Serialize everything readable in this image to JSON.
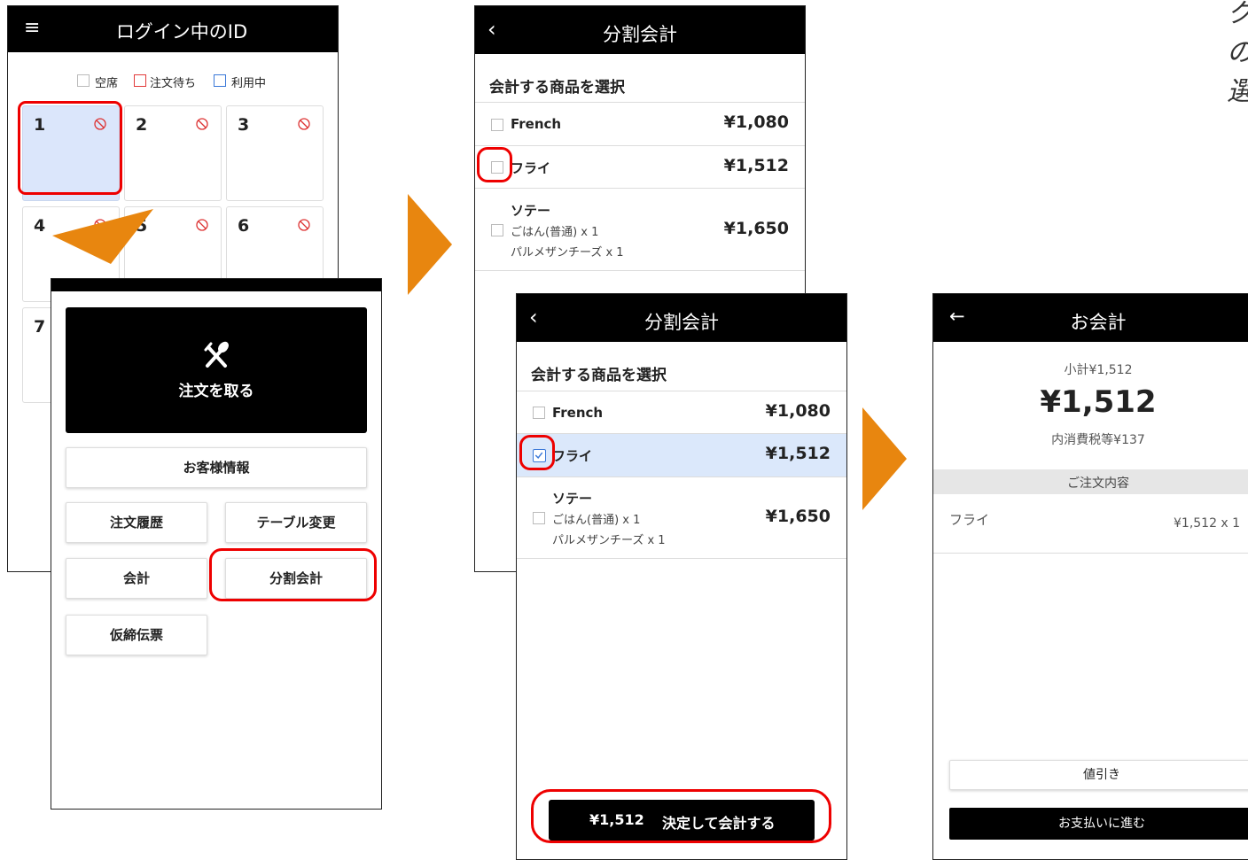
{
  "screen1": {
    "title": "ログイン中のID",
    "menu_icon": "hamburger-icon",
    "legend": [
      {
        "label": "空席",
        "color": "#bbbbbb"
      },
      {
        "label": "注文待ち",
        "color": "#e23b3b"
      },
      {
        "label": "利用中",
        "color": "#3a78d8"
      }
    ],
    "tables": [
      "1",
      "2",
      "3",
      "4",
      "5",
      "6",
      "7"
    ],
    "no_smoking_icon": "no-smoking-icon"
  },
  "menu_sheet": {
    "take_order_icon": "fork-knife-icon",
    "take_order": "注文を取る",
    "customer_info": "お客様情報",
    "order_history": "注文履歴",
    "table_change": "テーブル変更",
    "checkout": "会計",
    "split_checkout": "分割会計",
    "provisional_slip": "仮締伝票"
  },
  "split_screen": {
    "title": "分割会計",
    "back_icon": "chevron-left-icon",
    "section_title": "会計する商品を選択",
    "items": [
      {
        "name": "French",
        "price": "¥1,080"
      },
      {
        "name": "フライ",
        "price": "¥1,512"
      },
      {
        "name": "ソテー",
        "price": "¥1,650",
        "options": [
          "ごはん(普通) x 1",
          "パルメザンチーズ x 1"
        ]
      }
    ]
  },
  "split_screen_selected": {
    "title": "分割会計",
    "section_title": "会計する商品を選択",
    "items": [
      {
        "name": "French",
        "price": "¥1,080",
        "checked": false
      },
      {
        "name": "フライ",
        "price": "¥1,512",
        "checked": true
      },
      {
        "name": "ソテー",
        "price": "¥1,650",
        "checked": false,
        "options": [
          "ごはん(普通) x 1",
          "パルメザンチーズ x 1"
        ]
      }
    ],
    "confirm_amount": "¥1,512",
    "confirm_label": "決定して会計する",
    "selected_bg": "#dbe8fb"
  },
  "checkout_screen": {
    "title": "お会計",
    "back_icon": "arrow-left-icon",
    "subtotal": "小計¥1,512",
    "total": "¥1,512",
    "tax": "内消費税等¥137",
    "order_header": "ご注文内容",
    "order_item_name": "フライ",
    "order_item_price": "¥1,512 x 1",
    "discount_button": "値引き",
    "pay_button": "お支払いに進む"
  },
  "flow_arrow_color": "#e8860f",
  "highlight_color": "#e00000",
  "caption_fragments": [
    "ク",
    "の",
    "選"
  ]
}
